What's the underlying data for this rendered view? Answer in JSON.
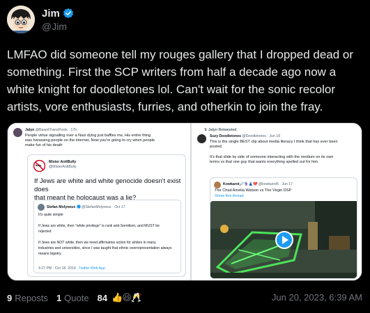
{
  "post": {
    "author": {
      "name": "Jim",
      "handle": "@Jim",
      "verified_color": "#1d9bf0"
    },
    "text": "LMFAO did someone tell my rouges gallery that I dropped dead or something.  First the SCP writers from half a decade ago now a white knight for doodletones lol.  Can't wait for the sonic recolor artists, vore enthusiasts, furries, and otherkin to join the fray.",
    "stats": {
      "reposts_count": "9",
      "reposts_label": "Reposts",
      "quotes_count": "1",
      "quotes_label": "Quote",
      "likes_count": "84",
      "reactions": "👍😆🥂",
      "date": "Jun 20, 2023, 6:39 AM"
    }
  },
  "media": {
    "left": {
      "author": "Jalyn",
      "handle_time": "@BasedTransPosts · 17h",
      "body": [
        "People virtue signalling over a Nazi dying just baffles me, His entire thing",
        "was harassing people on the internet, Now you're going to cry when people",
        "make fun of his death"
      ],
      "quoted": {
        "author": "Mister AntiBully",
        "handle": "@MisterAntiBully",
        "badge_text": "Bully",
        "text": [
          "If Jews are white and white genocide doesn't exist does",
          "that meant he holocaust was a lie?"
        ],
        "nested": {
          "author": "Stefan Molyneux",
          "handle_time": "@StefanMolyneux · Oct 17",
          "lines": [
            "It's quite simple",
            "",
            "If Jews are white, then \"white privilege\" is rank anti-Semitism, and MUST be",
            "rejected",
            "",
            "If Jews are NOT white, then we need affirmative action for whites in many",
            "industries and universities, since I was taught that ethnic overrepresentation always",
            "means bigotry."
          ],
          "footer_time": "4:27 PM · Oct 18, 2019 ·",
          "footer_link": "Twitter Web App"
        }
      }
    },
    "right": {
      "retweet_label": "Jalyn Retweeted",
      "author": "Suzy Doodletones",
      "handle_time": "@Doodletones · Jun 18",
      "body": [
        "This is the single BEST clip about media literacy I think that has ever been",
        "posted.",
        "",
        "It's that slide by side of someone interacting with the medium on its own",
        "terms vs that one guy that wants everything spelled out for him."
      ],
      "quoted": {
        "author": "Kowkarot",
        "emoji_tail": "🔎⚕️👗💔",
        "handle_time": "@kowkarot5 · Jun 17",
        "title": "The Chad Amelia Watson vs The Virgin DSP",
        "show_thread": "Show this thread"
      }
    }
  }
}
